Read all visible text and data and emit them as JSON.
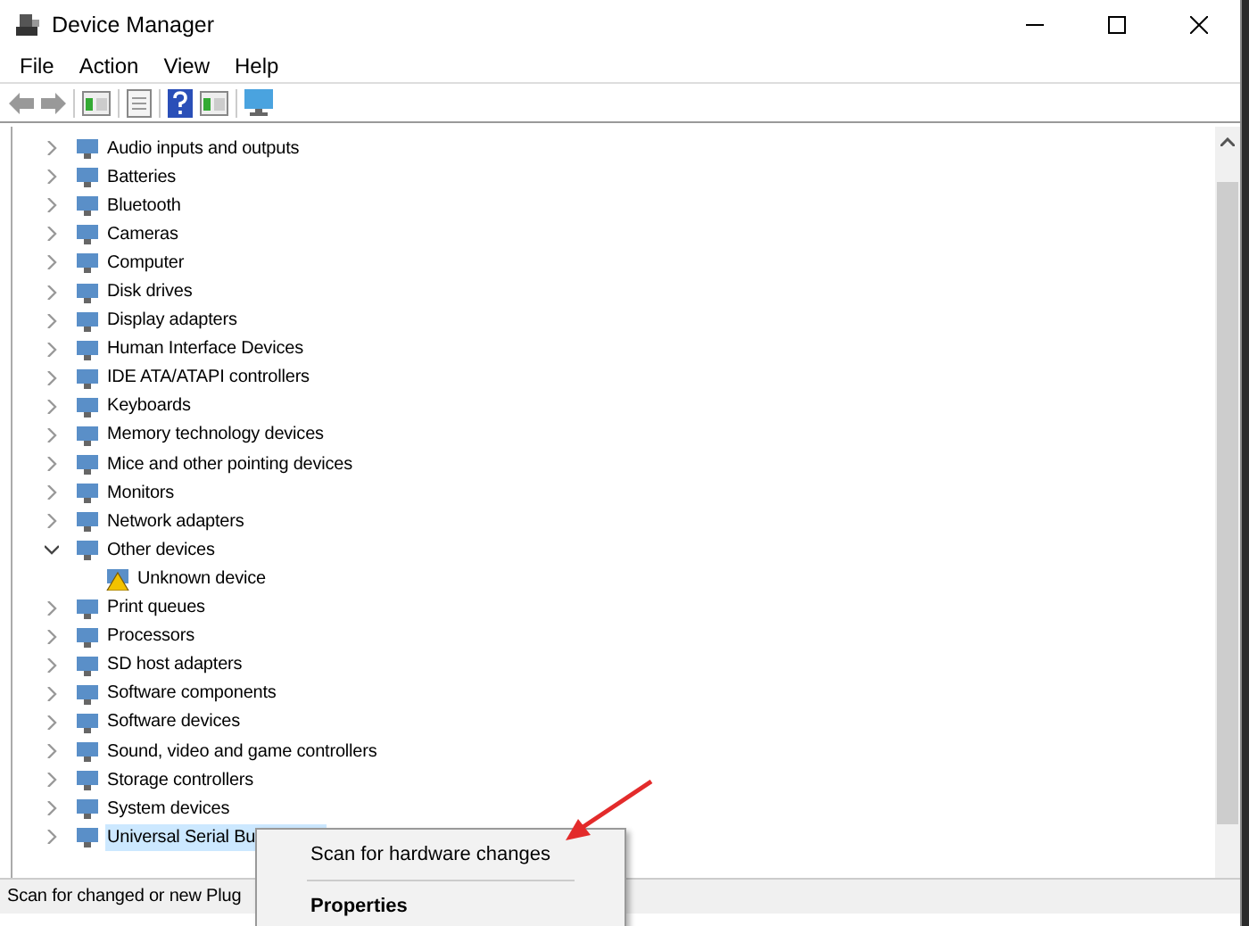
{
  "window": {
    "title": "Device Manager"
  },
  "menu": [
    "File",
    "Action",
    "View",
    "Help"
  ],
  "tree": [
    {
      "label": "Audio inputs and outputs",
      "expanded": false,
      "selected": false
    },
    {
      "label": "Batteries",
      "expanded": false,
      "selected": false
    },
    {
      "label": "Bluetooth",
      "expanded": false,
      "selected": false
    },
    {
      "label": "Cameras",
      "expanded": false,
      "selected": false
    },
    {
      "label": "Computer",
      "expanded": false,
      "selected": false
    },
    {
      "label": "Disk drives",
      "expanded": false,
      "selected": false
    },
    {
      "label": "Display adapters",
      "expanded": false,
      "selected": false
    },
    {
      "label": "Human Interface Devices",
      "expanded": false,
      "selected": false
    },
    {
      "label": "IDE ATA/ATAPI controllers",
      "expanded": false,
      "selected": false
    },
    {
      "label": "Keyboards",
      "expanded": false,
      "selected": false
    },
    {
      "label": "Memory technology devices",
      "expanded": false,
      "selected": false
    },
    {
      "label": "Mice and other pointing devices",
      "expanded": false,
      "selected": false
    },
    {
      "label": "Monitors",
      "expanded": false,
      "selected": false
    },
    {
      "label": "Network adapters",
      "expanded": false,
      "selected": false
    },
    {
      "label": "Other devices",
      "expanded": true,
      "selected": false,
      "children": [
        {
          "label": "Unknown device",
          "warning": true,
          "selected": false
        }
      ]
    },
    {
      "label": "Print queues",
      "expanded": false,
      "selected": false
    },
    {
      "label": "Processors",
      "expanded": false,
      "selected": false
    },
    {
      "label": "SD host adapters",
      "expanded": false,
      "selected": false
    },
    {
      "label": "Software components",
      "expanded": false,
      "selected": false
    },
    {
      "label": "Software devices",
      "expanded": false,
      "selected": false
    },
    {
      "label": "Sound, video and game controllers",
      "expanded": false,
      "selected": false
    },
    {
      "label": "Storage controllers",
      "expanded": false,
      "selected": false
    },
    {
      "label": "System devices",
      "expanded": false,
      "selected": false
    },
    {
      "label": "Universal Serial Bu",
      "expanded": false,
      "selected": true
    }
  ],
  "status_bar": "Scan for changed or new Plug",
  "context_menu": [
    {
      "label": "Scan for hardware changes",
      "default": false
    },
    {
      "label": "Properties",
      "default": true
    }
  ]
}
